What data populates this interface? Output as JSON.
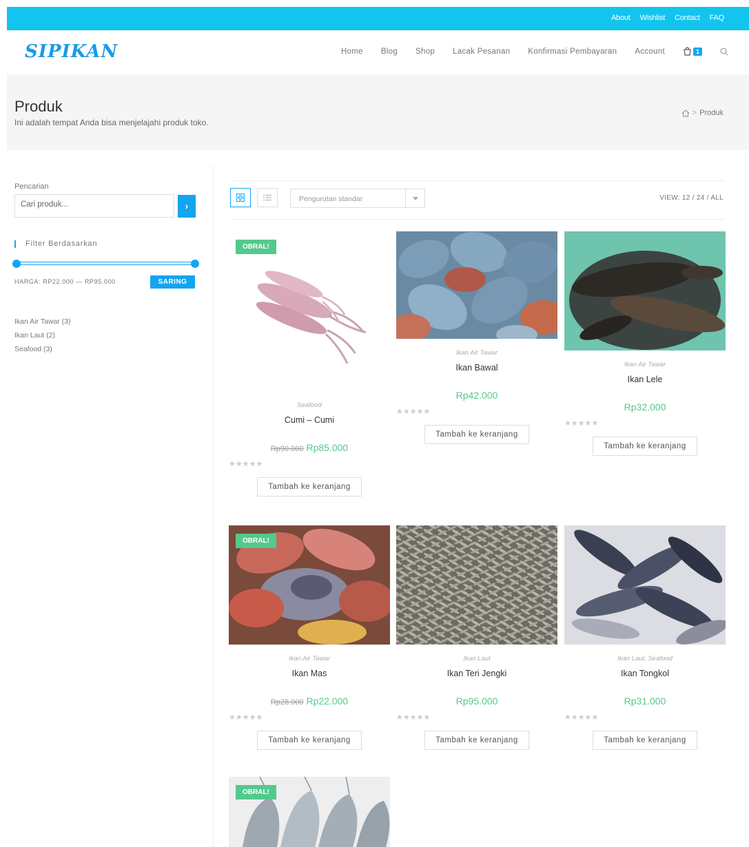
{
  "topbar": {
    "links": [
      "About",
      "Wishlist",
      "Contact",
      "FAQ"
    ]
  },
  "header": {
    "logo": "SIPIKAN",
    "nav": [
      "Home",
      "Blog",
      "Shop",
      "Lacak Pesanan",
      "Konfirmasi Pembayaran",
      "Account"
    ],
    "cart_count": "1"
  },
  "page": {
    "title": "Produk",
    "subtitle": "Ini adalah tempat Anda bisa menjelajahi produk toko.",
    "breadcrumb": "Produk"
  },
  "sidebar": {
    "search_label": "Pencarian",
    "search_placeholder": "Cari produk...",
    "filter_title": "Filter Berdasarkan",
    "price_range": "HARGA: RP22.000 — RP95.000",
    "filter_button": "SARING",
    "categories": [
      "Ikan Air Tawar (3)",
      "Ikan Laut (2)",
      "Seafood (3)"
    ]
  },
  "toolbar": {
    "sort_selected": "Pengurutan standar",
    "view_label": "VIEW: 12 / 24 / ALL"
  },
  "sale_label": "OBRAL!",
  "cart_button_label": "Tambah ke keranjang",
  "stars": "★★★★★",
  "products": [
    {
      "category": "Seafood",
      "name": "Cumi – Cumi",
      "old_price": "Rp90.000",
      "price": "Rp85.000",
      "sale": true
    },
    {
      "category": "Ikan Air Tawar",
      "name": "Ikan Bawal",
      "old_price": "",
      "price": "Rp42.000",
      "sale": false
    },
    {
      "category": "Ikan Air Tawar",
      "name": "Ikan Lele",
      "old_price": "",
      "price": "Rp32.000",
      "sale": false
    },
    {
      "category": "Ikan Air Tawar",
      "name": "Ikan Mas",
      "old_price": "Rp28.000",
      "price": "Rp22.000",
      "sale": true
    },
    {
      "category": "Ikan Laut",
      "name": "Ikan Teri Jengki",
      "old_price": "",
      "price": "Rp95.000",
      "sale": false
    },
    {
      "category": "Ikan Laut, Seafood",
      "name": "Ikan Tongkol",
      "old_price": "",
      "price": "Rp31.000",
      "sale": false
    },
    {
      "category": "",
      "name": "",
      "old_price": "",
      "price": "",
      "sale": true
    }
  ]
}
